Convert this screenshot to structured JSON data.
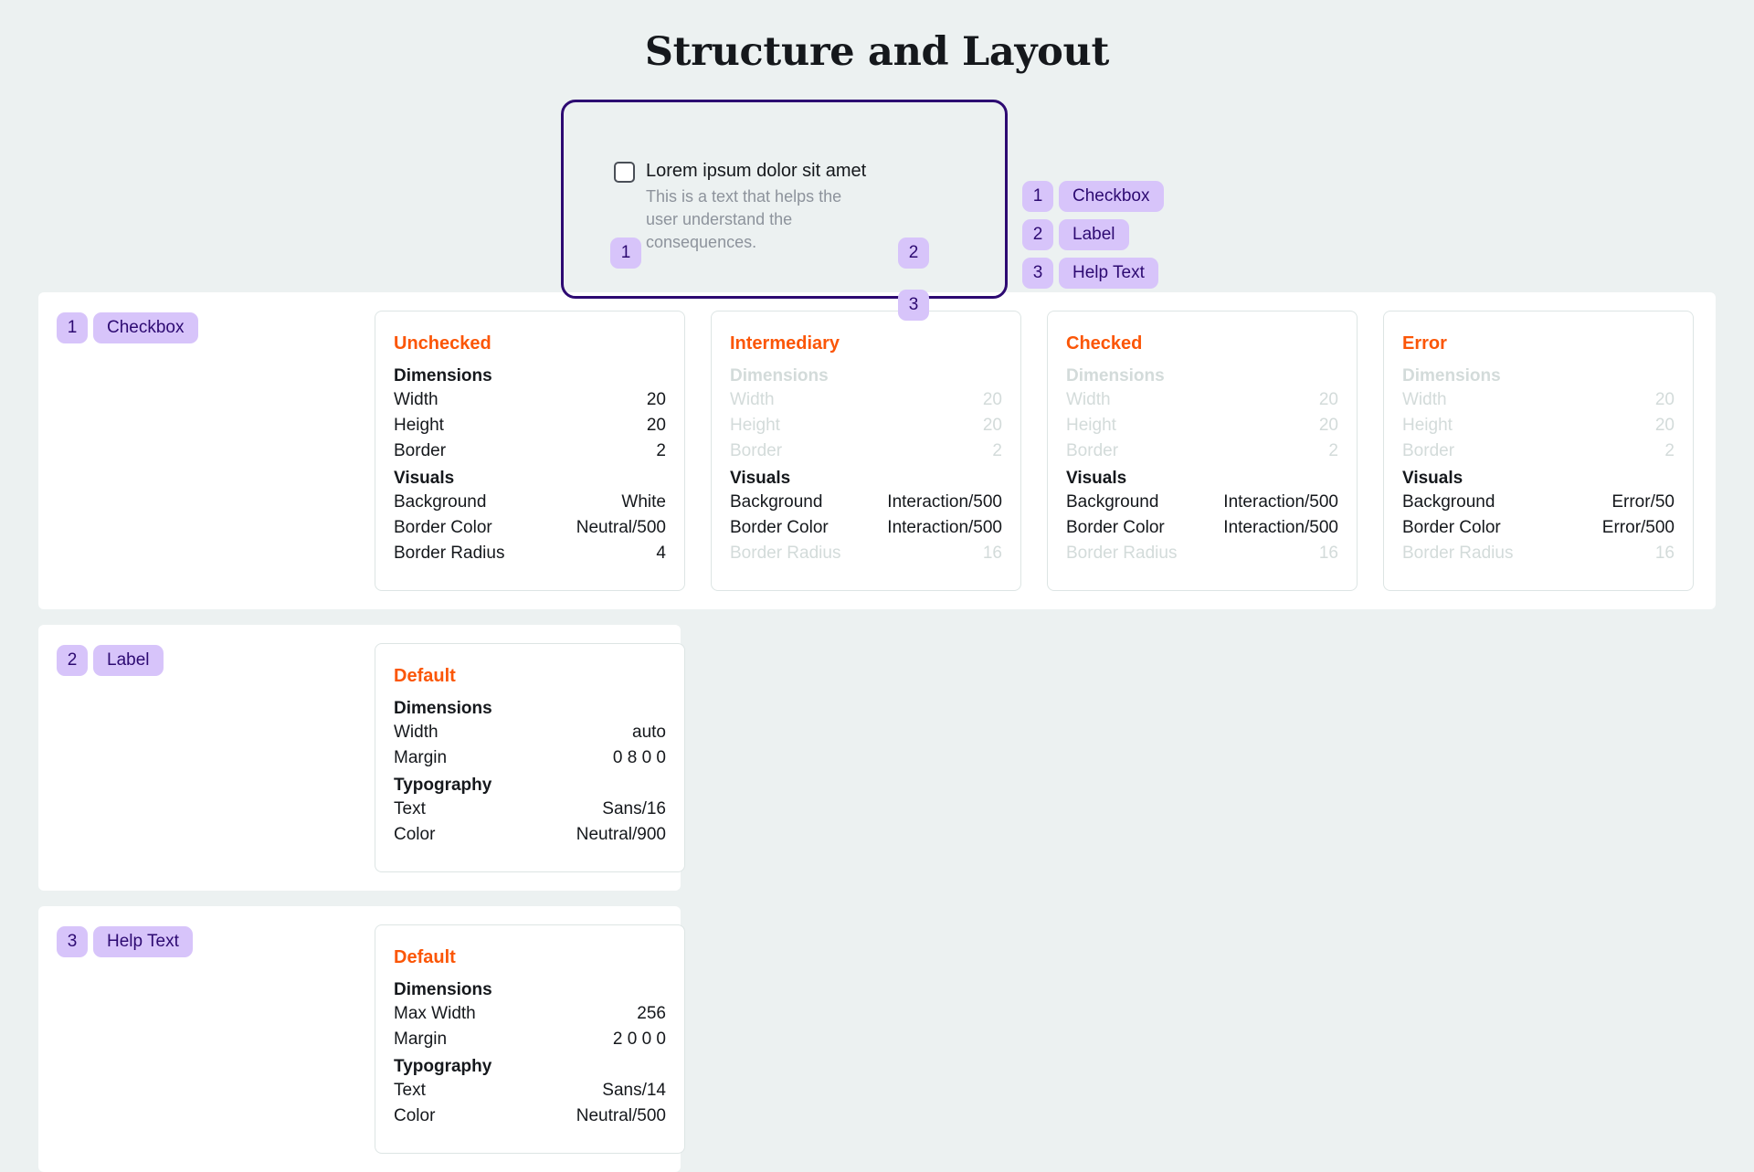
{
  "header": {
    "title": "Structure and Layout"
  },
  "anatomy": {
    "checkbox_label": "Lorem ipsum dolor sit amet",
    "help_text": "This is a text that helps the user understand the consequences.",
    "markers": [
      "1",
      "2",
      "3"
    ],
    "legend": [
      {
        "num": "1",
        "label": "Checkbox"
      },
      {
        "num": "2",
        "label": "Label"
      },
      {
        "num": "3",
        "label": "Help Text"
      }
    ]
  },
  "colors": {
    "page_background": "#ecf1f1",
    "accent_orange": "#fb5607",
    "badge_purple": "#d7c4fa",
    "badge_text": "#2d0a72",
    "frame_border": "#2d0a72",
    "dim_text": "#d3dbda",
    "card_border": "#dde5e4"
  },
  "sections": [
    {
      "num": "1",
      "tag": "Checkbox",
      "cards": [
        {
          "title": "Unchecked",
          "groups": [
            {
              "head": "Dimensions",
              "dim": false,
              "rows": [
                {
                  "k": "Width",
                  "v": "20",
                  "dim": false
                },
                {
                  "k": "Height",
                  "v": "20",
                  "dim": false
                },
                {
                  "k": "Border",
                  "v": "2",
                  "dim": false
                }
              ]
            },
            {
              "head": "Visuals",
              "dim": false,
              "rows": [
                {
                  "k": "Background",
                  "v": "White",
                  "dim": false
                },
                {
                  "k": "Border Color",
                  "v": "Neutral/500",
                  "dim": false
                },
                {
                  "k": "Border Radius",
                  "v": "4",
                  "dim": false
                }
              ]
            }
          ]
        },
        {
          "title": "Intermediary",
          "groups": [
            {
              "head": "Dimensions",
              "dim": true,
              "rows": [
                {
                  "k": "Width",
                  "v": "20",
                  "dim": true
                },
                {
                  "k": "Height",
                  "v": "20",
                  "dim": true
                },
                {
                  "k": "Border",
                  "v": "2",
                  "dim": true
                }
              ]
            },
            {
              "head": "Visuals",
              "dim": false,
              "rows": [
                {
                  "k": "Background",
                  "v": "Interaction/500",
                  "dim": false
                },
                {
                  "k": "Border Color",
                  "v": "Interaction/500",
                  "dim": false
                },
                {
                  "k": "Border Radius",
                  "v": "16",
                  "dim": true
                }
              ]
            }
          ]
        },
        {
          "title": "Checked",
          "groups": [
            {
              "head": "Dimensions",
              "dim": true,
              "rows": [
                {
                  "k": "Width",
                  "v": "20",
                  "dim": true
                },
                {
                  "k": "Height",
                  "v": "20",
                  "dim": true
                },
                {
                  "k": "Border",
                  "v": "2",
                  "dim": true
                }
              ]
            },
            {
              "head": "Visuals",
              "dim": false,
              "rows": [
                {
                  "k": "Background",
                  "v": "Interaction/500",
                  "dim": false
                },
                {
                  "k": "Border Color",
                  "v": "Interaction/500",
                  "dim": false
                },
                {
                  "k": "Border Radius",
                  "v": "16",
                  "dim": true
                }
              ]
            }
          ]
        },
        {
          "title": "Error",
          "groups": [
            {
              "head": "Dimensions",
              "dim": true,
              "rows": [
                {
                  "k": "Width",
                  "v": "20",
                  "dim": true
                },
                {
                  "k": "Height",
                  "v": "20",
                  "dim": true
                },
                {
                  "k": "Border",
                  "v": "2",
                  "dim": true
                }
              ]
            },
            {
              "head": "Visuals",
              "dim": false,
              "rows": [
                {
                  "k": "Background",
                  "v": "Error/50",
                  "dim": false
                },
                {
                  "k": "Border Color",
                  "v": "Error/500",
                  "dim": false
                },
                {
                  "k": "Border Radius",
                  "v": "16",
                  "dim": true
                }
              ]
            }
          ]
        }
      ]
    },
    {
      "num": "2",
      "tag": "Label",
      "cards": [
        {
          "title": "Default",
          "groups": [
            {
              "head": "Dimensions",
              "dim": false,
              "rows": [
                {
                  "k": "Width",
                  "v": "auto",
                  "dim": false
                },
                {
                  "k": "Margin",
                  "v": "0 8 0 0",
                  "dim": false
                }
              ]
            },
            {
              "head": "Typography",
              "dim": false,
              "rows": [
                {
                  "k": "Text",
                  "v": "Sans/16",
                  "dim": false
                },
                {
                  "k": "Color",
                  "v": "Neutral/900",
                  "dim": false
                }
              ]
            }
          ]
        }
      ]
    },
    {
      "num": "3",
      "tag": "Help Text",
      "cards": [
        {
          "title": "Default",
          "groups": [
            {
              "head": "Dimensions",
              "dim": false,
              "rows": [
                {
                  "k": "Max Width",
                  "v": "256",
                  "dim": false
                },
                {
                  "k": "Margin",
                  "v": "2 0 0 0",
                  "dim": false
                }
              ]
            },
            {
              "head": "Typography",
              "dim": false,
              "rows": [
                {
                  "k": "Text",
                  "v": "Sans/14",
                  "dim": false
                },
                {
                  "k": "Color",
                  "v": "Neutral/500",
                  "dim": false
                }
              ]
            }
          ]
        }
      ]
    }
  ]
}
